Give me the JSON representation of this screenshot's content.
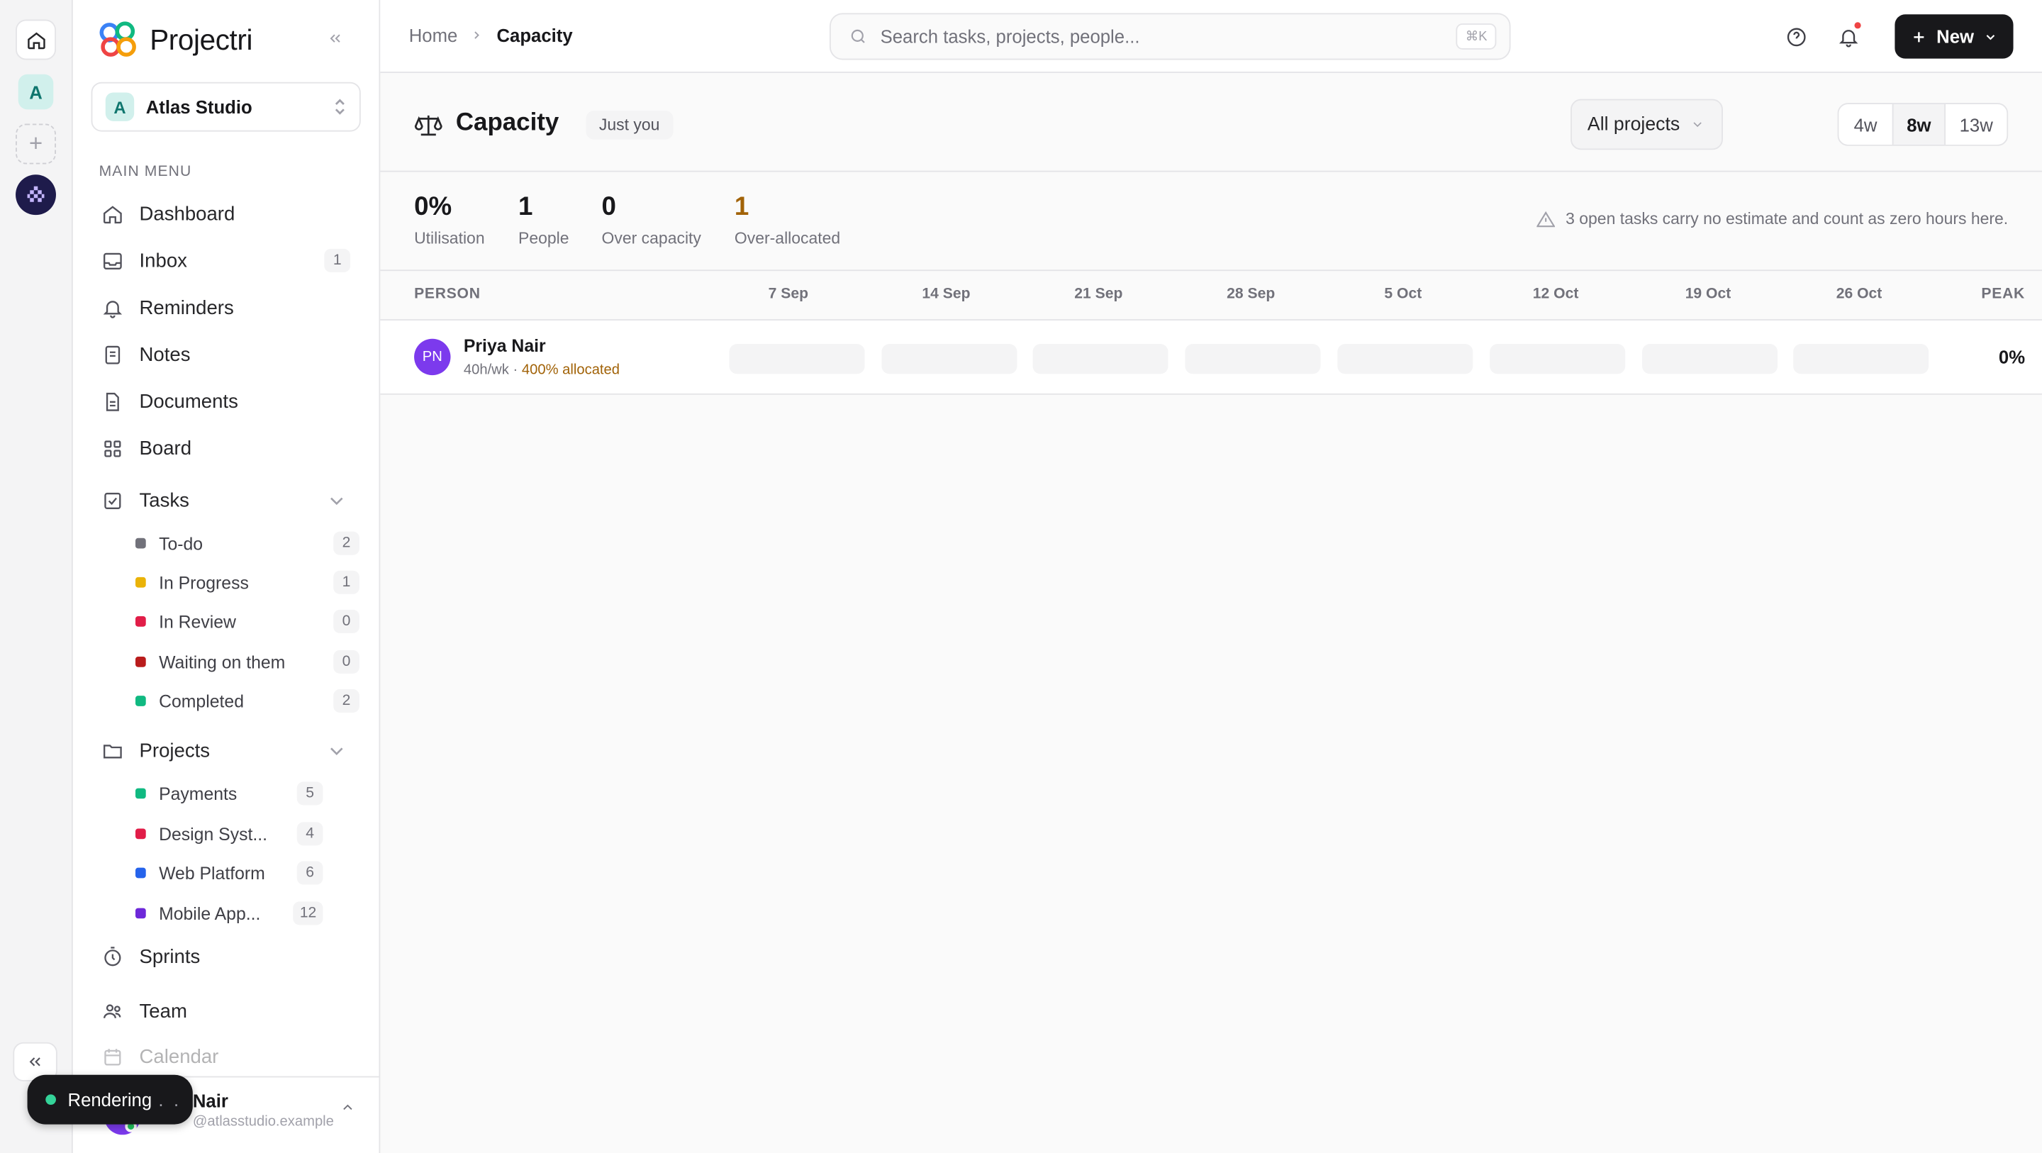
{
  "app": {
    "name": "Projectri"
  },
  "workspace": {
    "initial": "A",
    "name": "Atlas Studio"
  },
  "sidebar": {
    "menu_label": "MAIN MENU",
    "items": [
      {
        "label": "Dashboard",
        "icon": "home-icon"
      },
      {
        "label": "Inbox",
        "icon": "inbox-icon",
        "count": "1"
      },
      {
        "label": "Reminders",
        "icon": "bell-icon"
      },
      {
        "label": "Notes",
        "icon": "note-icon"
      },
      {
        "label": "Documents",
        "icon": "document-icon"
      },
      {
        "label": "Board",
        "icon": "grid-icon"
      }
    ],
    "tasks": {
      "label": "Tasks",
      "statuses": [
        {
          "label": "To-do",
          "count": "2",
          "color": "#71717a"
        },
        {
          "label": "In Progress",
          "count": "1",
          "color": "#eab308"
        },
        {
          "label": "In Review",
          "count": "0",
          "color": "#e11d48"
        },
        {
          "label": "Waiting on them",
          "count": "0",
          "color": "#b91c1c"
        },
        {
          "label": "Completed",
          "count": "2",
          "color": "#10b981"
        }
      ]
    },
    "projects": {
      "label": "Projects",
      "items": [
        {
          "label": "Payments",
          "count": "5",
          "color": "#10b981"
        },
        {
          "label": "Design Syst...",
          "count": "4",
          "color": "#e11d48"
        },
        {
          "label": "Web Platform",
          "count": "6",
          "color": "#2563eb"
        },
        {
          "label": "Mobile App...",
          "count": "12",
          "color": "#6d28d9"
        }
      ]
    },
    "more": [
      {
        "label": "Sprints",
        "icon": "timer-icon"
      },
      {
        "label": "Team",
        "icon": "team-icon"
      },
      {
        "label": "Calendar",
        "icon": "calendar-icon"
      }
    ],
    "user": {
      "name": "Nair",
      "email": "@atlasstudio.example"
    }
  },
  "toast": {
    "label": "Rendering",
    "ellipsis": ". ."
  },
  "topbar": {
    "breadcrumb_home": "Home",
    "breadcrumb_current": "Capacity",
    "search_placeholder": "Search tasks, projects, people...",
    "search_shortcut": "⌘K",
    "new_label": "New"
  },
  "page": {
    "title": "Capacity",
    "badge": "Just you",
    "project_filter": "All projects",
    "ranges": [
      "4w",
      "8w",
      "13w"
    ],
    "active_range": "8w"
  },
  "stats": [
    {
      "value": "0%",
      "label": "Utilisation"
    },
    {
      "value": "1",
      "label": "People"
    },
    {
      "value": "0",
      "label": "Over capacity"
    },
    {
      "value": "1",
      "label": "Over-allocated"
    }
  ],
  "notice": "3 open tasks carry no estimate and count as zero hours here.",
  "table": {
    "person_header": "PERSON",
    "peak_header": "PEAK",
    "weeks": [
      "7 Sep",
      "14 Sep",
      "21 Sep",
      "28 Sep",
      "5 Oct",
      "12 Oct",
      "19 Oct",
      "26 Oct"
    ],
    "rows": [
      {
        "initials": "PN",
        "name": "Priya Nair",
        "hours": "40h/wk",
        "sep": " · ",
        "allocation": "400% allocated",
        "peak": "0%"
      }
    ]
  }
}
